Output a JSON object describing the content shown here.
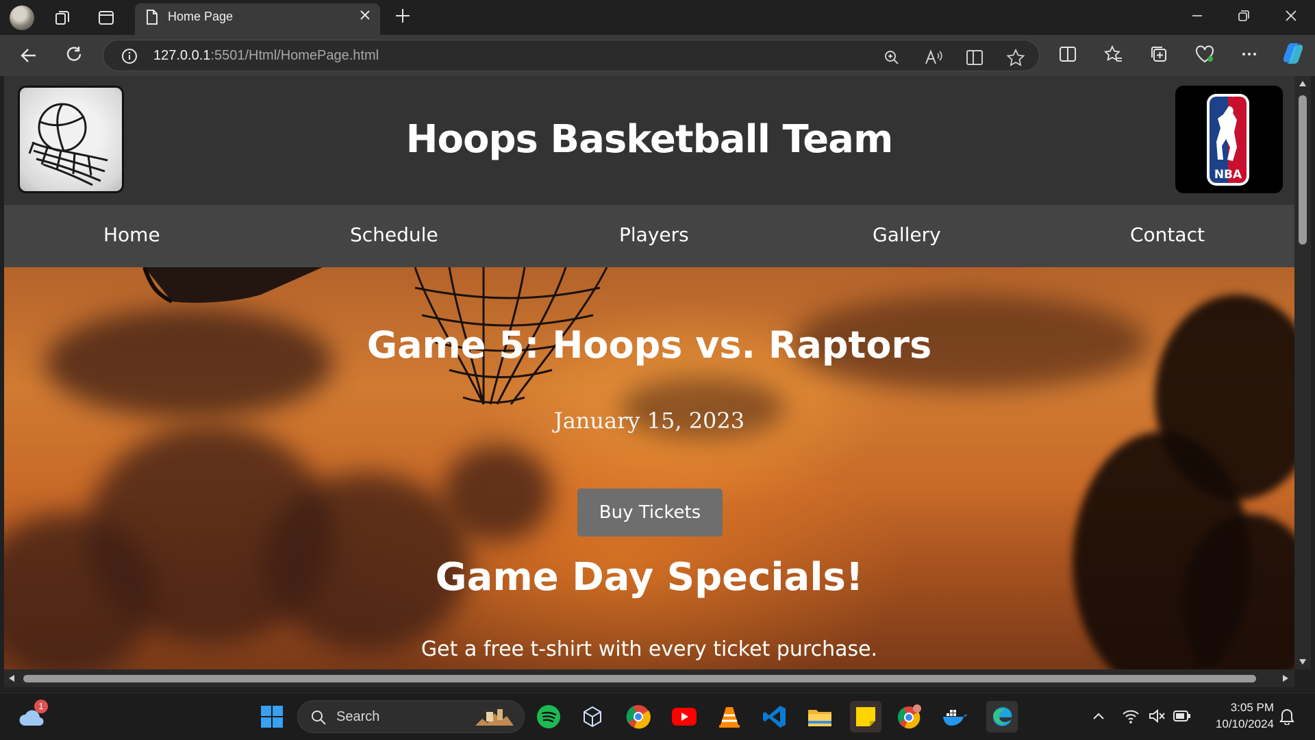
{
  "browser": {
    "tab_title": "Home Page",
    "url_host": "127.0.0.1",
    "url_rest": ":5501/Html/HomePage.html"
  },
  "site": {
    "title": "Hoops Basketball Team",
    "right_logo_text": "NBA",
    "nav": [
      "Home",
      "Schedule",
      "Players",
      "Gallery",
      "Contact"
    ]
  },
  "hero": {
    "headline": "Game 5: Hoops vs. Raptors",
    "date": "January 15, 2023",
    "button_label": "Buy Tickets",
    "specials_title": "Game Day Specials!",
    "specials_text": "Get a free t-shirt with every ticket purchase."
  },
  "taskbar": {
    "search_label": "Search",
    "notification_count": "1",
    "time": "3:05 PM",
    "date": "10/10/2024"
  },
  "colors": {
    "header_bg": "#333333",
    "nav_bg": "#444444",
    "button_bg": "#6e6e6e"
  }
}
